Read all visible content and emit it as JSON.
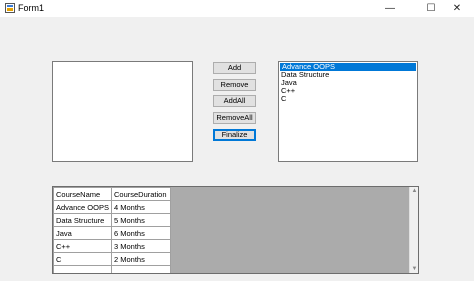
{
  "window": {
    "title": "Form1",
    "minimize_glyph": "—",
    "maximize_glyph": "☐",
    "close_glyph": "✕"
  },
  "buttons": {
    "add": "Add",
    "remove": "Remove",
    "add_all": "AddAll",
    "remove_all": "RemoveAll",
    "finalize": "Finalize"
  },
  "right_list": {
    "items": [
      "Advance OOPS",
      "Data Structure",
      "Java",
      "C++",
      "C"
    ],
    "selected_index": 0
  },
  "left_list": {
    "items": []
  },
  "grid": {
    "columns": [
      "CourseName",
      "CourseDuration"
    ],
    "rows": [
      [
        "Advance OOPS",
        "4 Months"
      ],
      [
        "Data Structure",
        "5 Months"
      ],
      [
        "Java",
        "6 Months"
      ],
      [
        "C++",
        "3 Months"
      ],
      [
        "C",
        "2 Months"
      ],
      [
        "",
        ""
      ]
    ]
  },
  "colors": {
    "selection": "#0078d7",
    "grid_background": "#ababab"
  }
}
